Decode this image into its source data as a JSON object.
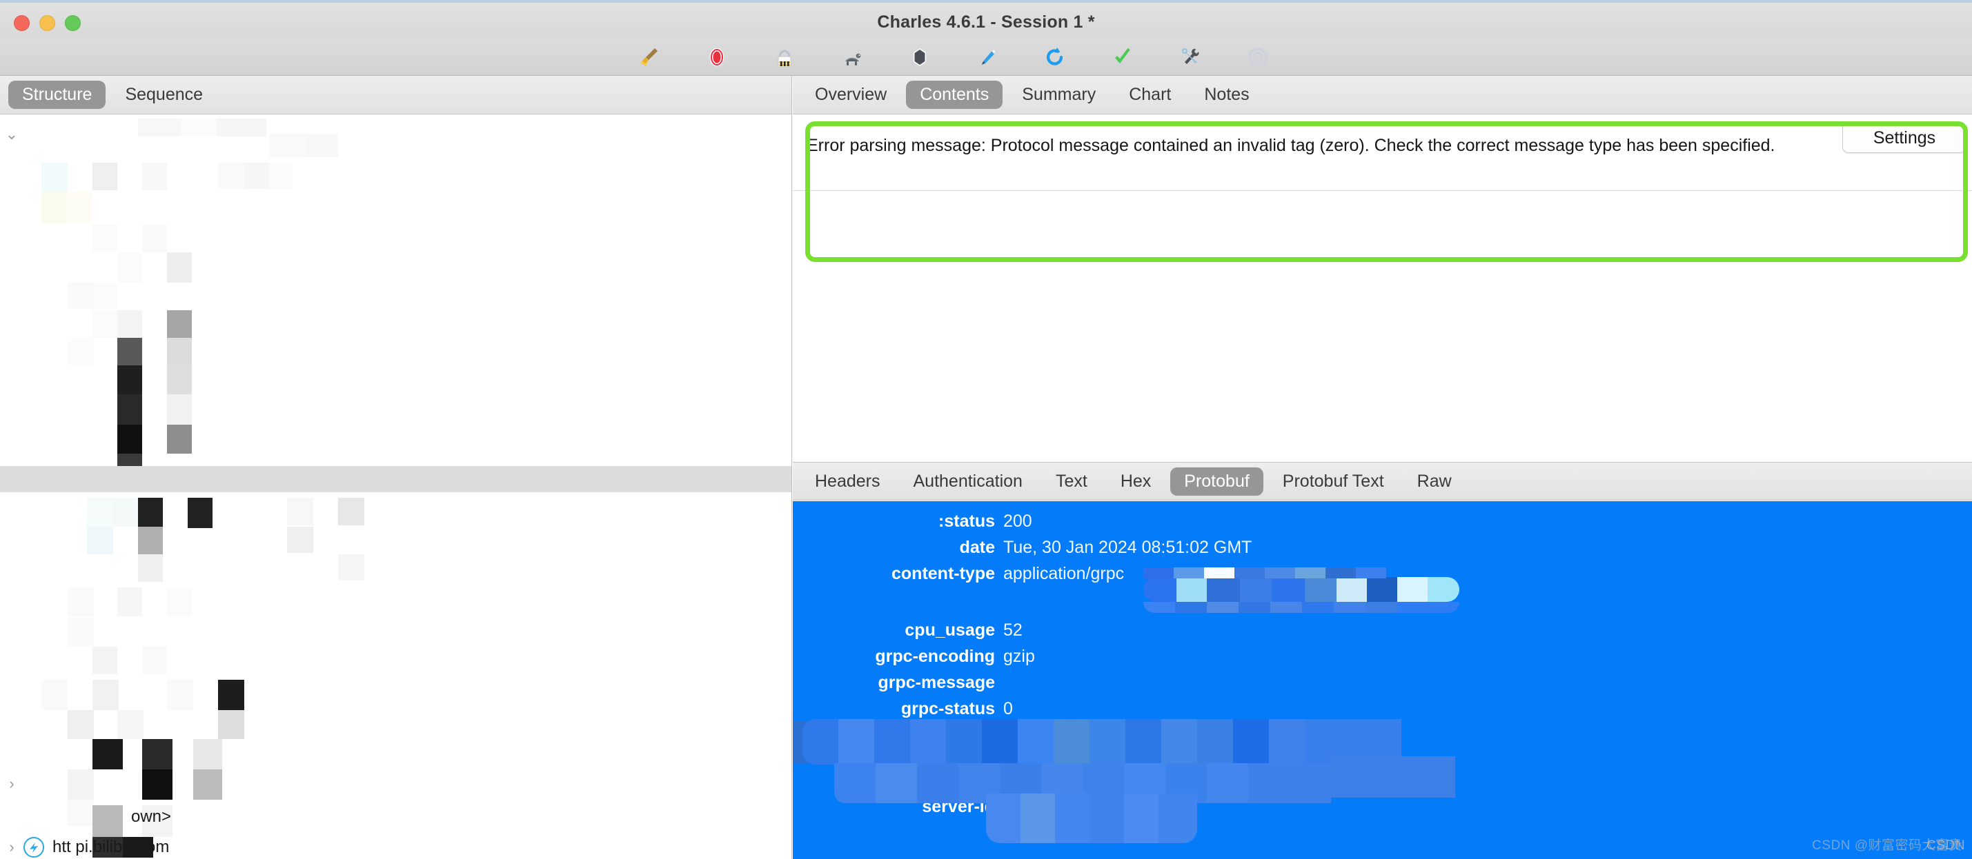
{
  "window": {
    "title": "Charles 4.6.1 - Session 1 *",
    "traffic_lights": [
      "close",
      "minimize",
      "maximize"
    ]
  },
  "toolbar": {
    "icons": [
      {
        "name": "clear-broom-icon",
        "label": "Clear"
      },
      {
        "name": "record-icon",
        "label": "Start/Stop Recording"
      },
      {
        "name": "throttle-barrier-icon",
        "label": "Throttling"
      },
      {
        "name": "tortoise-icon",
        "label": "Throttle Settings"
      },
      {
        "name": "breakpoint-icon",
        "label": "Breakpoints"
      },
      {
        "name": "compose-pen-icon",
        "label": "Compose"
      },
      {
        "name": "repeat-icon",
        "label": "Repeat"
      },
      {
        "name": "validate-check-icon",
        "label": "Validate"
      },
      {
        "name": "tools-icon",
        "label": "Tools"
      },
      {
        "name": "settings-gear-icon",
        "label": "Settings"
      }
    ]
  },
  "left_panel": {
    "tabs": [
      {
        "label": "Structure",
        "selected": true
      },
      {
        "label": "Sequence",
        "selected": false
      }
    ],
    "tree_rows": [
      {
        "indent": 0,
        "chevron": "down",
        "redacted": true,
        "text": ""
      },
      {
        "indent": 1,
        "chevron": "none",
        "redacted": true,
        "text": ""
      },
      {
        "indent": 1,
        "chevron": "none",
        "redacted": true,
        "text": ""
      },
      {
        "indent": 1,
        "chevron": "none",
        "redacted": true,
        "text": ""
      },
      {
        "indent": 1,
        "chevron": "none",
        "redacted": true,
        "text": ""
      },
      {
        "indent": 1,
        "chevron": "none",
        "redacted": true,
        "text": ""
      },
      {
        "indent": 1,
        "chevron": "none",
        "redacted": true,
        "text": ""
      },
      {
        "indent": 1,
        "chevron": "none",
        "redacted": true,
        "text": "",
        "selected": true
      },
      {
        "indent": 1,
        "chevron": "none",
        "redacted": true,
        "text": ""
      },
      {
        "indent": 1,
        "chevron": "none",
        "redacted": true,
        "text": ""
      },
      {
        "indent": 1,
        "chevron": "none",
        "redacted": true,
        "text": ""
      },
      {
        "indent": 1,
        "chevron": "none",
        "redacted": true,
        "text": ""
      },
      {
        "indent": 1,
        "chevron": "right",
        "redacted": true,
        "text": ""
      },
      {
        "indent": 1,
        "chevron": "none",
        "redacted": false,
        "text": "own>"
      },
      {
        "indent": 0,
        "chevron": "right",
        "redacted": false,
        "text": "htt        pi.bilibili.com",
        "host_icon": true
      }
    ]
  },
  "right_panel": {
    "tabs": [
      {
        "label": "Overview",
        "selected": false
      },
      {
        "label": "Contents",
        "selected": true
      },
      {
        "label": "Summary",
        "selected": false
      },
      {
        "label": "Chart",
        "selected": false
      },
      {
        "label": "Notes",
        "selected": false
      }
    ],
    "contents": {
      "error_message": "Error parsing message: Protocol message contained an invalid tag (zero).  Check the correct message type has been specified.",
      "settings_label": "Settings",
      "highlight_color": "#79e02f"
    },
    "bottom_tabs": [
      {
        "label": "Headers",
        "selected": false
      },
      {
        "label": "Authentication",
        "selected": false
      },
      {
        "label": "Text",
        "selected": false
      },
      {
        "label": "Hex",
        "selected": false
      },
      {
        "label": "Protobuf",
        "selected": true
      },
      {
        "label": "Protobuf Text",
        "selected": false
      },
      {
        "label": "Raw",
        "selected": false
      }
    ],
    "headers": {
      "background_color": "#047bf8",
      "rows": [
        {
          "name": ":status",
          "value": "200",
          "redacted": false
        },
        {
          "name": "date",
          "value": "Tue, 30 Jan 2024 08:51:02 GMT",
          "redacted": false
        },
        {
          "name": "content-type",
          "value": "application/grpc",
          "redacted": false
        },
        {
          "name": "",
          "value": "8",
          "redacted": true
        },
        {
          "name": "cpu_usage",
          "value": "52",
          "redacted": false
        },
        {
          "name": "grpc-encoding",
          "value": "gzip",
          "redacted": false
        },
        {
          "name": "grpc-message",
          "value": "",
          "redacted": false
        },
        {
          "name": "grpc-status",
          "value": "0",
          "redacted": false
        },
        {
          "name": "",
          "value": "",
          "redacted": true
        },
        {
          "name": "",
          "value": "",
          "redacted": true
        },
        {
          "name": "server-id",
          "value": "",
          "redacted": true
        }
      ]
    }
  },
  "watermark": {
    "text_back": "CSDN @财富密码大富贵",
    "text_front": "CSDN"
  }
}
